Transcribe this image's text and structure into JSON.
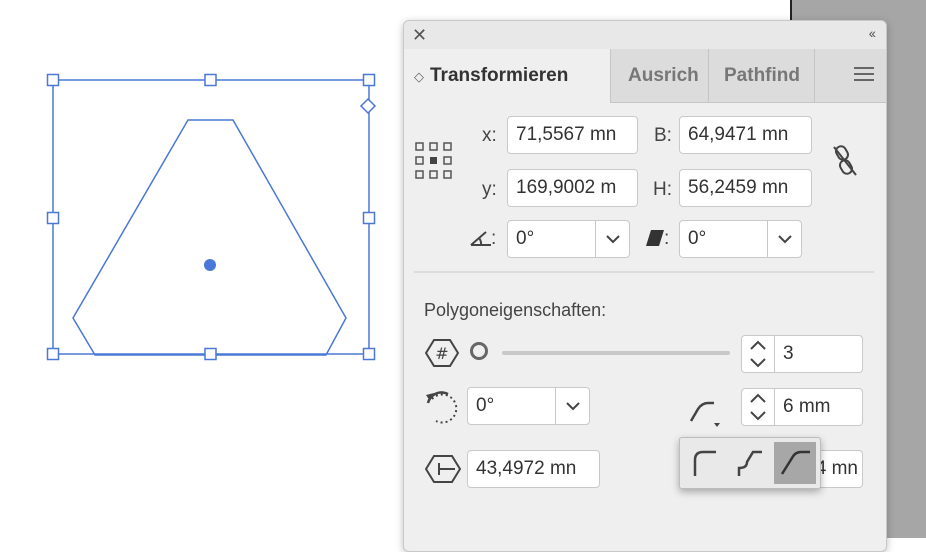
{
  "panel": {
    "tabs": [
      {
        "label": "Transformieren"
      },
      {
        "label": "Ausrich"
      },
      {
        "label": "Pathfind"
      }
    ],
    "transform": {
      "x_label": "x:",
      "x_value": "71,5567 mn",
      "y_label": "y:",
      "y_value": "169,9002 m",
      "w_label": "B:",
      "w_value": "64,9471 mn",
      "h_label": "H:",
      "h_value": "56,2459 mn",
      "rotate_value": "0°",
      "shear_value": "0°",
      "rotate_label": ":",
      "shear_label": ":"
    },
    "polygon": {
      "section_title": "Polygoneigenschaften:",
      "sides_value": "3",
      "rotation_value": "0°",
      "corner_radius_value": "6 mm",
      "side_length_value": "43,4972 mn",
      "hidden_field_value": "4 mn"
    }
  },
  "icons": {
    "close": "close-icon",
    "collapse": "collapse-icon",
    "menu": "panel-menu-icon",
    "reference_point": "reference-point-icon",
    "constrain_link": "constrain-proportions-icon",
    "rotate": "rotate-angle-icon",
    "shear": "shear-icon",
    "sides": "polygon-sides-icon",
    "polygon_rotate": "polygon-rotation-icon",
    "corner_type": "corner-type-icon",
    "side_length": "side-length-icon"
  },
  "colors": {
    "selection": "#4a78d6",
    "panel_bg": "#efefef",
    "tab_bg": "#dcdcdc"
  }
}
